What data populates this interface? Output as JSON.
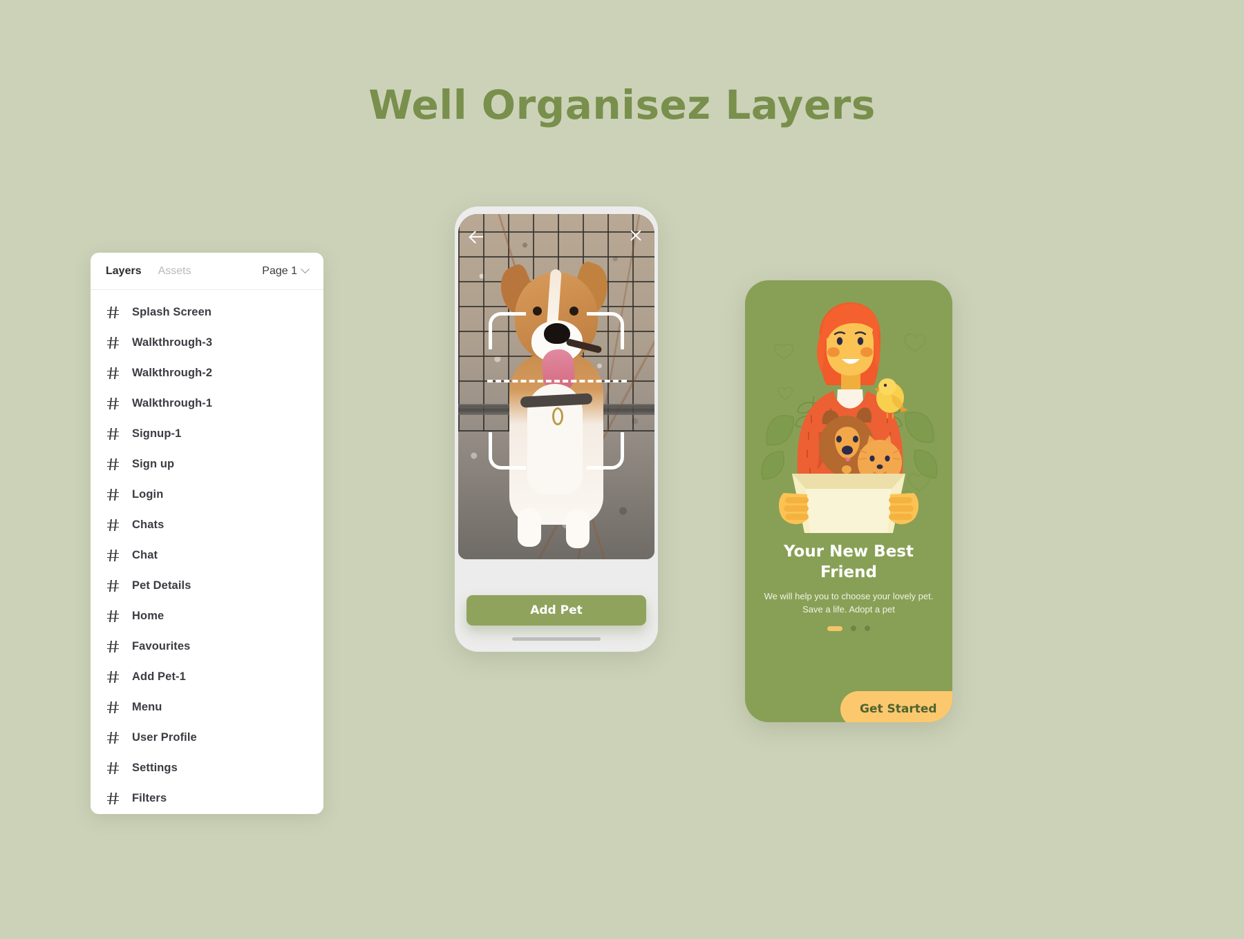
{
  "page": {
    "title": "Well Organisez Layers",
    "background_color": "#ccd2b8",
    "title_color": "#798f4c"
  },
  "layers_panel": {
    "tabs": [
      {
        "label": "Layers",
        "active": true
      },
      {
        "label": "Assets",
        "active": false
      }
    ],
    "page_selector": {
      "label": "Page 1",
      "icon": "chevron-down-icon"
    },
    "row_icon": "hash-icon",
    "layers": [
      {
        "label": "Splash Screen"
      },
      {
        "label": "Walkthrough-3"
      },
      {
        "label": "Walkthrough-2"
      },
      {
        "label": "Walkthrough-1"
      },
      {
        "label": "Signup-1"
      },
      {
        "label": "Sign up"
      },
      {
        "label": "Login"
      },
      {
        "label": "Chats"
      },
      {
        "label": "Chat"
      },
      {
        "label": "Pet Details"
      },
      {
        "label": "Home"
      },
      {
        "label": "Favourites"
      },
      {
        "label": "Add Pet-1"
      },
      {
        "label": "Menu"
      },
      {
        "label": "User Profile"
      },
      {
        "label": "Settings"
      },
      {
        "label": "Filters"
      }
    ]
  },
  "phone_scan": {
    "back_icon": "arrow-left-icon",
    "close_icon": "close-icon",
    "photo_alt": "dog-photo",
    "scan_frame": "scan-frame-overlay",
    "add_pet_label": "Add Pet",
    "add_pet_color": "#8fa35d"
  },
  "phone_onboarding": {
    "background_color": "#88a055",
    "illustration_alt": "woman-holding-box-with-pets-illustration",
    "title": "Your New Best Friend",
    "subtitle": "We will help you to choose your lovely pet. Save a life. Adopt a pet",
    "dots": {
      "count": 3,
      "active_index": 0,
      "active_color": "#f5c46a"
    },
    "get_started_label": "Get Started",
    "get_started_color": "#fcc86e"
  }
}
